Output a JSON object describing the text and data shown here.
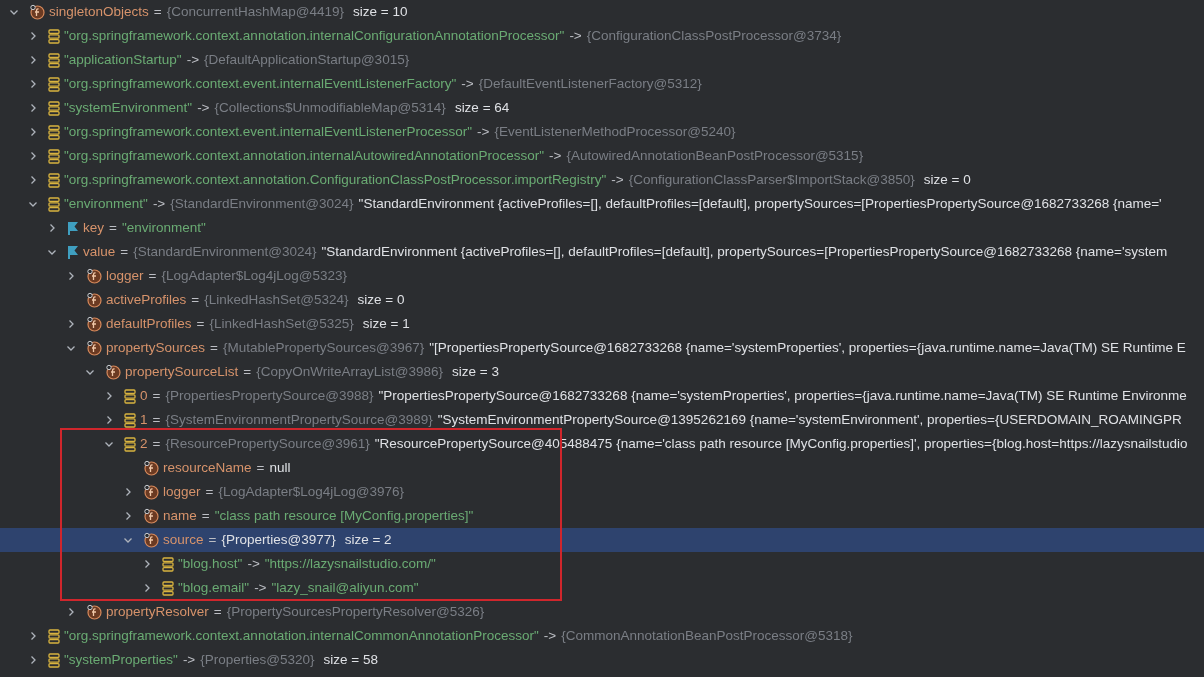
{
  "tree": [
    {
      "kind": "field",
      "name": "singletonObjects",
      "op": "=",
      "type": "{ConcurrentHashMap@4419}",
      "size": "size = 10",
      "expanded": true,
      "selected": false,
      "children": [
        {
          "kind": "map-entry",
          "name": "\"org.springframework.context.annotation.internalConfigurationAnnotationProcessor\"",
          "op": "->",
          "type": "{ConfigurationClassPostProcessor@3734}",
          "expanded": false,
          "selected": false
        },
        {
          "kind": "map-entry",
          "name": "\"applicationStartup\"",
          "op": "->",
          "type": "{DefaultApplicationStartup@3015}",
          "expanded": false,
          "selected": false
        },
        {
          "kind": "map-entry",
          "name": "\"org.springframework.context.event.internalEventListenerFactory\"",
          "op": "->",
          "type": "{DefaultEventListenerFactory@5312}",
          "expanded": false,
          "selected": false
        },
        {
          "kind": "map-entry",
          "name": "\"systemEnvironment\"",
          "op": "->",
          "type": "{Collections$UnmodifiableMap@5314}",
          "size": "size = 64",
          "expanded": false,
          "selected": false
        },
        {
          "kind": "map-entry",
          "name": "\"org.springframework.context.event.internalEventListenerProcessor\"",
          "op": "->",
          "type": "{EventListenerMethodProcessor@5240}",
          "expanded": false,
          "selected": false
        },
        {
          "kind": "map-entry",
          "name": "\"org.springframework.context.annotation.internalAutowiredAnnotationProcessor\"",
          "op": "->",
          "type": "{AutowiredAnnotationBeanPostProcessor@5315}",
          "expanded": false,
          "selected": false
        },
        {
          "kind": "map-entry",
          "name": "\"org.springframework.context.annotation.ConfigurationClassPostProcessor.importRegistry\"",
          "op": "->",
          "type": "{ConfigurationClassParser$ImportStack@3850}",
          "size": "size = 0",
          "expanded": false,
          "selected": false
        },
        {
          "kind": "map-entry",
          "name": "\"environment\"",
          "op": "->",
          "type": "{StandardEnvironment@3024}",
          "value": "\"StandardEnvironment {activeProfiles=[], defaultProfiles=[default], propertySources=[PropertiesPropertySource@1682733268 {name='",
          "expanded": true,
          "selected": false,
          "children": [
            {
              "kind": "flag",
              "name": "key",
              "op": "=",
              "value": "\"environment\"",
              "quoted": true,
              "expanded": false,
              "selected": false
            },
            {
              "kind": "flag",
              "name": "value",
              "op": "=",
              "type": "{StandardEnvironment@3024}",
              "value": "\"StandardEnvironment {activeProfiles=[], defaultProfiles=[default], propertySources=[PropertiesPropertySource@1682733268 {name='system",
              "expanded": true,
              "selected": false,
              "children": [
                {
                  "kind": "field",
                  "name": "logger",
                  "op": "=",
                  "type": "{LogAdapter$Log4jLog@5323}",
                  "expanded": false,
                  "selected": false
                },
                {
                  "kind": "field",
                  "name": "activeProfiles",
                  "op": "=",
                  "type": "{LinkedHashSet@5324}",
                  "size": "size = 0",
                  "selected": false
                },
                {
                  "kind": "field",
                  "name": "defaultProfiles",
                  "op": "=",
                  "type": "{LinkedHashSet@5325}",
                  "size": "size = 1",
                  "expanded": false,
                  "selected": false
                },
                {
                  "kind": "field",
                  "name": "propertySources",
                  "op": "=",
                  "type": "{MutablePropertySources@3967}",
                  "value": "\"[PropertiesPropertySource@1682733268 {name='systemProperties', properties={java.runtime.name=Java(TM) SE Runtime E",
                  "expanded": true,
                  "selected": false,
                  "children": [
                    {
                      "kind": "field",
                      "name": "propertySourceList",
                      "op": "=",
                      "type": "{CopyOnWriteArrayList@3986}",
                      "size": "size = 3",
                      "expanded": true,
                      "selected": false,
                      "children": [
                        {
                          "kind": "array-item",
                          "name": "0",
                          "op": "=",
                          "type": "{PropertiesPropertySource@3988}",
                          "value": "\"PropertiesPropertySource@1682733268 {name='systemProperties', properties={java.runtime.name=Java(TM) SE Runtime Environme",
                          "expanded": false,
                          "selected": false
                        },
                        {
                          "kind": "array-item",
                          "name": "1",
                          "op": "=",
                          "type": "{SystemEnvironmentPropertySource@3989}",
                          "value": "\"SystemEnvironmentPropertySource@1395262169 {name='systemEnvironment', properties={USERDOMAIN_ROAMINGPR",
                          "expanded": false,
                          "selected": false
                        },
                        {
                          "kind": "array-item",
                          "name": "2",
                          "op": "=",
                          "type": "{ResourcePropertySource@3961}",
                          "value": "\"ResourcePropertySource@405488475 {name='class path resource [MyConfig.properties]', properties={blog.host=https://lazysnailstudio",
                          "expanded": true,
                          "selected": false,
                          "framed": true,
                          "children": [
                            {
                              "kind": "field",
                              "name": "resourceName",
                              "op": "=",
                              "value": "null",
                              "selected": false
                            },
                            {
                              "kind": "field",
                              "name": "logger",
                              "op": "=",
                              "type": "{LogAdapter$Log4jLog@3976}",
                              "expanded": false,
                              "selected": false
                            },
                            {
                              "kind": "field",
                              "name": "name",
                              "op": "=",
                              "value": "\"class path resource [MyConfig.properties]\"",
                              "quoted": true,
                              "expanded": false,
                              "selected": false
                            },
                            {
                              "kind": "field",
                              "name": "source",
                              "op": "=",
                              "type": "{Properties@3977}",
                              "size": "size = 2",
                              "expanded": true,
                              "selected": true,
                              "children": [
                                {
                                  "kind": "map-entry",
                                  "name": "\"blog.host\"",
                                  "op": "->",
                                  "value": "\"https://lazysnailstudio.com/\"",
                                  "quoted": true,
                                  "expanded": false,
                                  "selected": false
                                },
                                {
                                  "kind": "map-entry",
                                  "name": "\"blog.email\"",
                                  "op": "->",
                                  "value": "\"lazy_snail@aliyun.com\"",
                                  "quoted": true,
                                  "expanded": false,
                                  "selected": false
                                }
                              ]
                            }
                          ]
                        }
                      ]
                    }
                  ]
                },
                {
                  "kind": "field",
                  "name": "propertyResolver",
                  "op": "=",
                  "type": "{PropertySourcesPropertyResolver@5326}",
                  "expanded": false,
                  "selected": false
                }
              ]
            }
          ]
        },
        {
          "kind": "map-entry",
          "name": "\"org.springframework.context.annotation.internalCommonAnnotationProcessor\"",
          "op": "->",
          "type": "{CommonAnnotationBeanPostProcessor@5318}",
          "expanded": false,
          "selected": false
        },
        {
          "kind": "map-entry",
          "name": "\"systemProperties\"",
          "op": "->",
          "type": "{Properties@5320}",
          "size": "size = 58",
          "expanded": false,
          "selected": false
        }
      ]
    }
  ]
}
